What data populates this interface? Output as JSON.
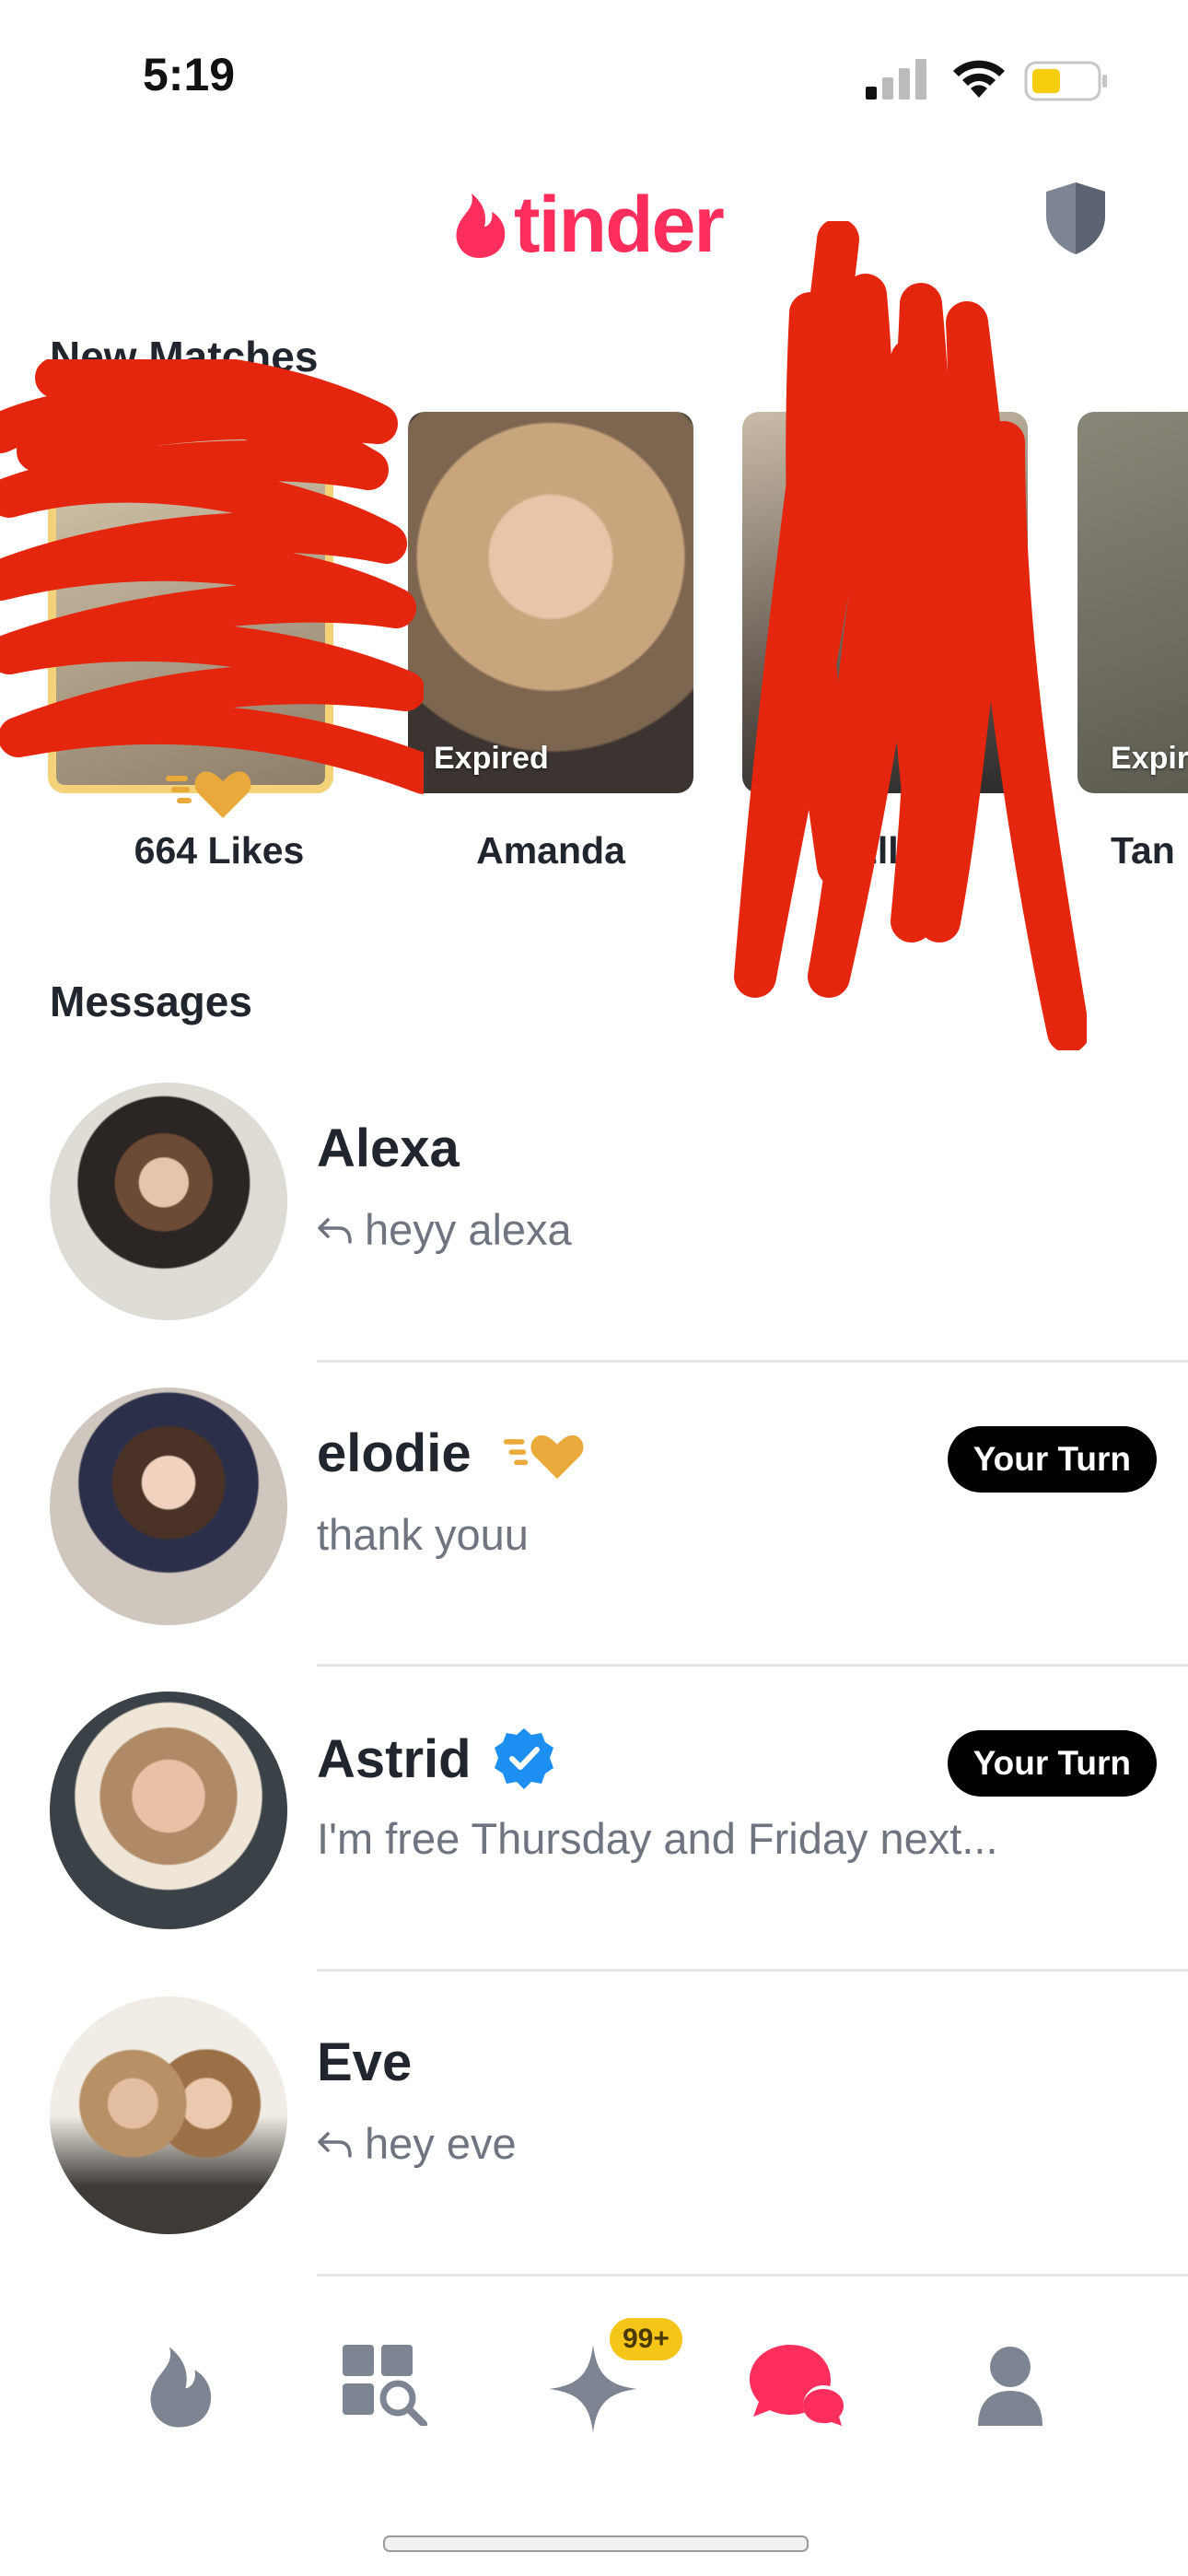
{
  "status_bar": {
    "time": "5:19"
  },
  "header": {
    "logo_text": "tinder"
  },
  "new_matches": {
    "title": "New Matches",
    "items": [
      {
        "name": "664 Likes",
        "label": ""
      },
      {
        "name": "Amanda",
        "label": "Expired"
      },
      {
        "name": "Ella",
        "label": "Expired"
      },
      {
        "name": "Tan",
        "label": "Expir"
      }
    ]
  },
  "messages": {
    "title": "Messages",
    "items": [
      {
        "name": "Alexa",
        "preview": "heyy alexa",
        "replied": true,
        "your_turn": ""
      },
      {
        "name": "elodie",
        "preview": "thank youu",
        "replied": false,
        "your_turn": "Your Turn"
      },
      {
        "name": "Astrid",
        "preview": "I'm free Thursday and Friday next...",
        "replied": false,
        "your_turn": "Your Turn"
      },
      {
        "name": "Eve",
        "preview": "hey eve",
        "replied": true,
        "your_turn": ""
      }
    ]
  },
  "tab_bar": {
    "tabs": [
      "flame-icon",
      "explore-icon",
      "sparkle-icon",
      "chat-icon",
      "profile-icon"
    ],
    "badge": "99+"
  },
  "colors": {
    "brand": "#fd2e5c",
    "gold": "#e9a93b",
    "verified": "#1d8ff2",
    "icon_grey": "#7c8591"
  }
}
